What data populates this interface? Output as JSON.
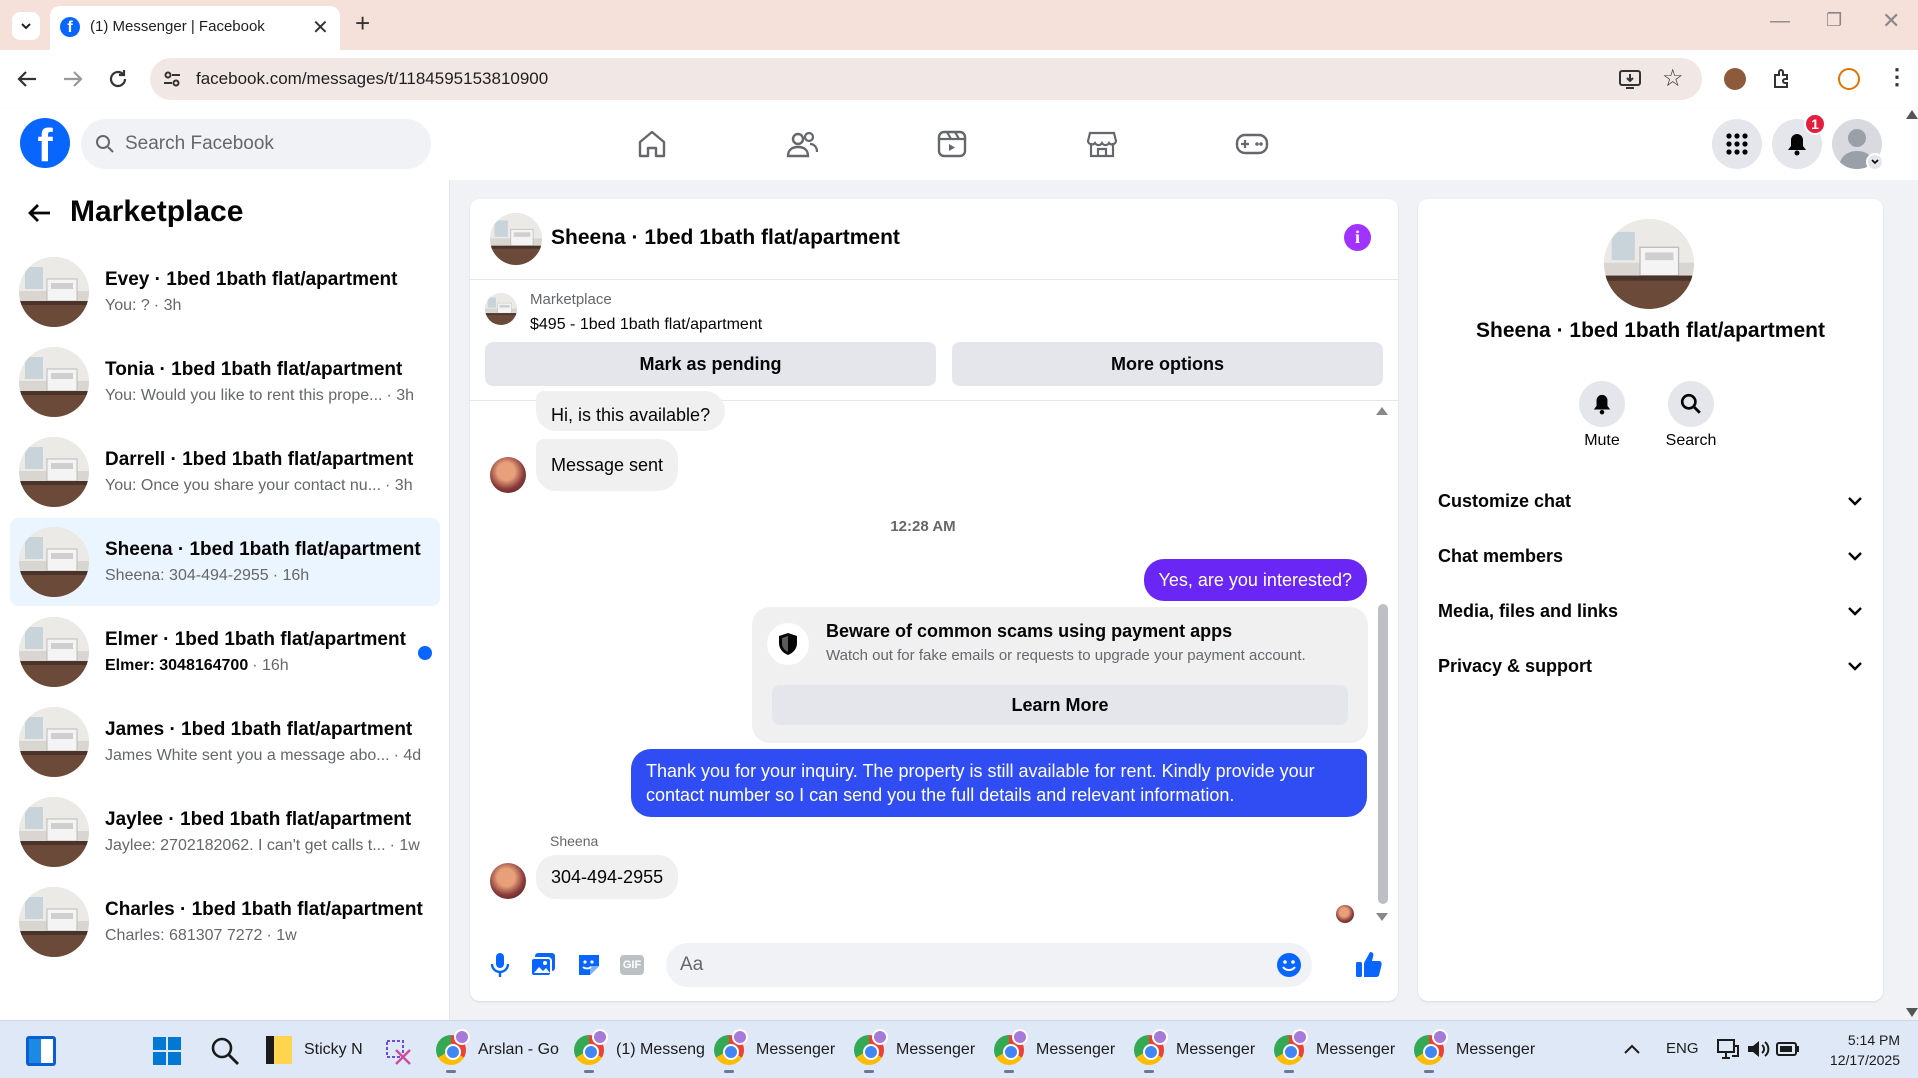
{
  "browser": {
    "tab_title": "(1) Messenger | Facebook",
    "url": "facebook.com/messages/t/1184595153810900"
  },
  "fb": {
    "search_placeholder": "Search Facebook",
    "notif_count": "1"
  },
  "sidebar": {
    "title": "Marketplace",
    "conversations": [
      {
        "name": "Evey · 1bed 1bath flat/apartment",
        "preview": "You: ?",
        "time": "· 3h",
        "bold": false,
        "unread": false
      },
      {
        "name": "Tonia · 1bed 1bath flat/apartment",
        "preview": "You: Would you like to rent this prope...",
        "time": "· 3h",
        "bold": false,
        "unread": false
      },
      {
        "name": "Darrell · 1bed 1bath flat/apartment",
        "preview": "You: Once you share your contact nu...",
        "time": "· 3h",
        "bold": false,
        "unread": false
      },
      {
        "name": "Sheena · 1bed 1bath flat/apartment",
        "preview": "Sheena: 304-494-2955",
        "time": "· 16h",
        "bold": false,
        "unread": false
      },
      {
        "name": "Elmer · 1bed 1bath flat/apartment",
        "preview": "Elmer: 3048164700",
        "time": "· 16h",
        "bold": true,
        "unread": true
      },
      {
        "name": "James · 1bed 1bath flat/apartment",
        "preview": "James White sent you a message abo...",
        "time": "· 4d",
        "bold": false,
        "unread": false
      },
      {
        "name": "Jaylee · 1bed 1bath flat/apartment",
        "preview": "Jaylee: 2702182062. I can't get calls t...",
        "time": "· 1w",
        "bold": false,
        "unread": false
      },
      {
        "name": "Charles · 1bed 1bath flat/apartment",
        "preview": "Charles: 681307 7272",
        "time": "· 1w",
        "bold": false,
        "unread": false
      }
    ]
  },
  "chat": {
    "title": "Sheena · 1bed 1bath flat/apartment",
    "listing_source": "Marketplace",
    "listing": "$495 - 1bed 1bath flat/apartment",
    "mark_pending": "Mark as pending",
    "more_options": "More options",
    "messages": {
      "m1": "Hi, is this available?",
      "m2": "Message sent",
      "timestamp": "12:28 AM",
      "m3": "Yes, are you interested?",
      "warning_title": "Beware of common scams using payment apps",
      "warning_body": "Watch out for fake emails or requests to upgrade your payment account.",
      "learn_more": "Learn More",
      "m4": "Thank you for your inquiry. The property is still available for rent. Kindly provide your contact number so I can send you the full details and relevant information.",
      "sender": "Sheena",
      "m5": "304-494-2955"
    },
    "composer_placeholder": "Aa"
  },
  "info": {
    "name": "Sheena · 1bed 1bath flat/apartment",
    "mute": "Mute",
    "search": "Search",
    "sections": [
      "Customize chat",
      "Chat members",
      "Media, files and links",
      "Privacy & support"
    ]
  },
  "taskbar": {
    "sticky": "Sticky N",
    "apps": [
      "Arslan - Go",
      "(1) Messeng",
      "Messenger",
      "Messenger",
      "Messenger",
      "Messenger",
      "Messenger",
      "Messenger"
    ],
    "lang": "ENG",
    "time": "5:14 PM",
    "date": "12/17/2025"
  },
  "colors": {
    "accent": "#6a26f4",
    "fb_blue": "#0866ff",
    "notif_red": "#e41e3f",
    "selected_row": "#ebf5ff"
  }
}
